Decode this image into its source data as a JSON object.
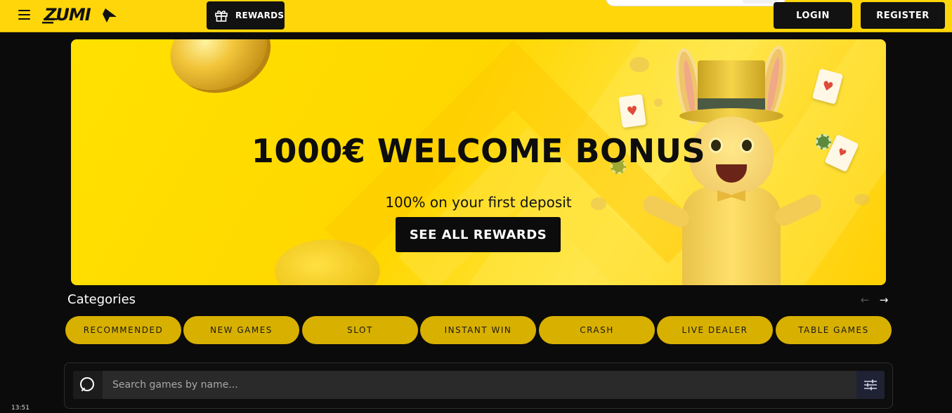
{
  "header": {
    "logo_text": "ZUMI",
    "rewards_label": "REWARDS",
    "login_label": "LOGIN",
    "register_label": "REGISTER"
  },
  "banner": {
    "title": "1000€ WELCOME BONUS",
    "subtitle": "100% on your first deposit",
    "cta_label": "SEE ALL REWARDS"
  },
  "categories": {
    "title": "Categories",
    "items": [
      {
        "label": "RECOMMENDED"
      },
      {
        "label": "NEW GAMES"
      },
      {
        "label": "SLOT"
      },
      {
        "label": "INSTANT WIN"
      },
      {
        "label": "CRASH"
      },
      {
        "label": "LIVE DEALER"
      },
      {
        "label": "TABLE GAMES"
      }
    ]
  },
  "search": {
    "placeholder": "Search games by name..."
  },
  "status": {
    "clock": "13:51"
  },
  "colors": {
    "brand_yellow": "#ffd60a",
    "category_pill": "#d8b000",
    "background": "#0b0b0c"
  }
}
